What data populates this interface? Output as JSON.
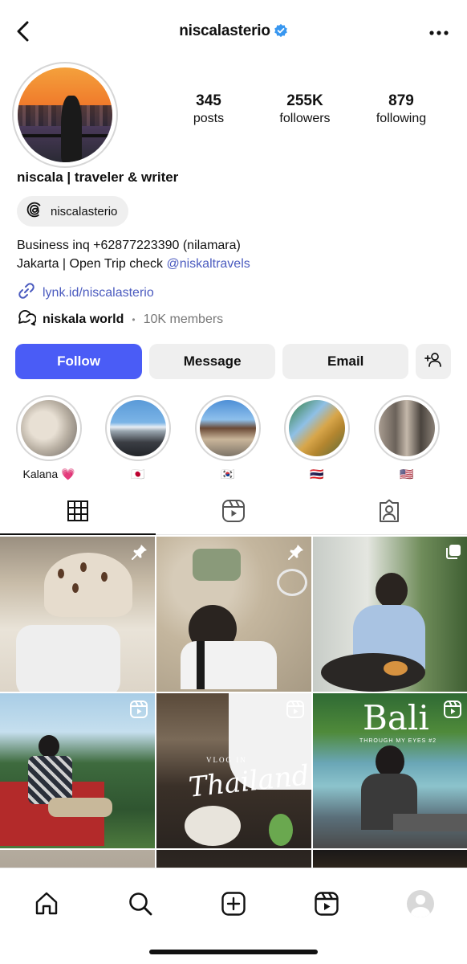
{
  "header": {
    "username": "niscalasterio",
    "back_icon": "chevron-left-icon",
    "more_icon": "more-horizontal-icon",
    "verified_color": "#3897f0"
  },
  "stats": [
    {
      "num": "345",
      "label": "posts"
    },
    {
      "num": "255K",
      "label": "followers"
    },
    {
      "num": "879",
      "label": "following"
    }
  ],
  "profile": {
    "name": "niscala | traveler & writer",
    "threads_handle": "niscalasterio",
    "bio_line1": "Business inq +62877223390 (nilamara)",
    "bio_line2_prefix": "Jakarta | Open Trip check ",
    "bio_mention": "@niskaltravels",
    "link": "lynk.id/niscalasterio",
    "channel_name": "niskala world",
    "channel_sep": "•",
    "channel_members": "10K members"
  },
  "actions": {
    "follow": "Follow",
    "message": "Message",
    "email": "Email"
  },
  "highlights": [
    {
      "caption": "Kalana 💗"
    },
    {
      "caption": "🇯🇵"
    },
    {
      "caption": "🇰🇷"
    },
    {
      "caption": "🇹🇭"
    },
    {
      "caption": "🇺🇸"
    }
  ],
  "grid": {
    "posts": [
      {
        "badge": "pin-icon"
      },
      {
        "badge": "pin-icon"
      },
      {
        "badge": "carousel-icon"
      },
      {
        "badge": "reel-icon"
      },
      {
        "badge": "reel-icon",
        "overlay_top": "VLOG IN",
        "overlay_main": "Thailand"
      },
      {
        "badge": "reel-icon",
        "overlay_top": "Bali",
        "overlay_main": "THROUGH MY EYES #2"
      }
    ]
  },
  "colors": {
    "accent": "#4a5cf6",
    "link": "#4b5bbf",
    "button_gray": "#efefef"
  }
}
